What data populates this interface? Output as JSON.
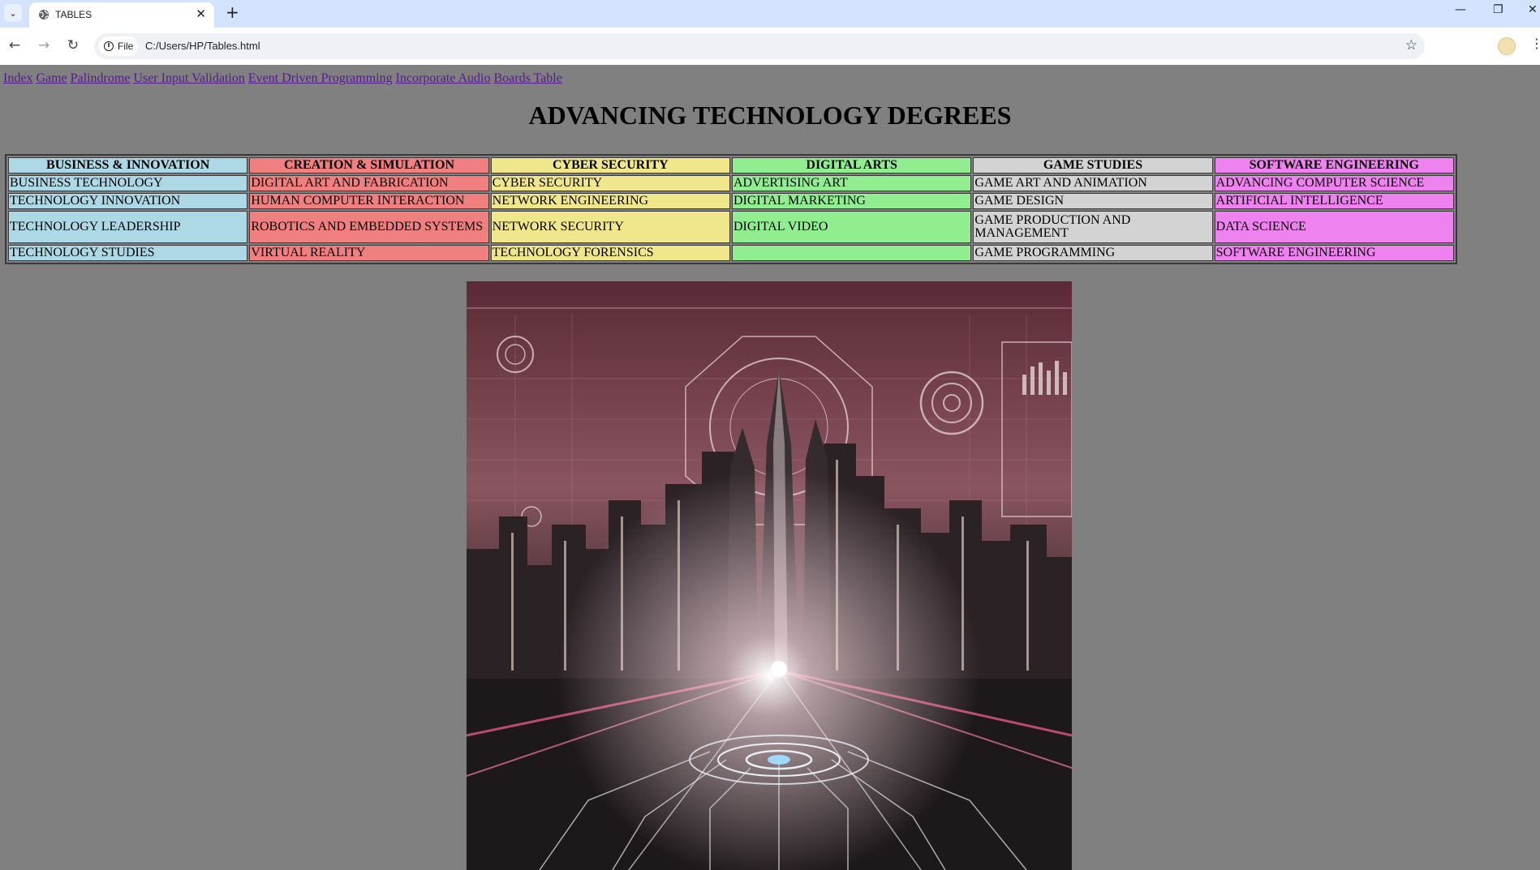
{
  "browser": {
    "tab_title": "TABLES",
    "site_chip": "File",
    "url": "C:/Users/HP/Tables.html"
  },
  "nav": {
    "links": [
      "Index",
      "Game",
      "Palindrome",
      "User Input Validation",
      "Event Driven Programming",
      "Incorporate Audio",
      "Boards Table"
    ]
  },
  "page": {
    "title": "ADVANCING TECHNOLOGY DEGREES"
  },
  "table": {
    "columns": [
      {
        "header": "BUSINESS & INNOVATION",
        "color": "#add8e6",
        "items": [
          "BUSINESS TECHNOLOGY",
          "TECHNOLOGY INNOVATION",
          "TECHNOLOGY LEADERSHIP",
          "TECHNOLOGY STUDIES"
        ]
      },
      {
        "header": "CREATION & SIMULATION",
        "color": "#f08080",
        "items": [
          "DIGITAL ART AND FABRICATION",
          "HUMAN COMPUTER INTERACTION",
          "ROBOTICS AND EMBEDDED SYSTEMS",
          "VIRTUAL REALITY"
        ]
      },
      {
        "header": "CYBER SECURITY",
        "color": "#f0e68c",
        "items": [
          "CYBER SECURITY",
          "NETWORK ENGINEERING",
          "NETWORK SECURITY",
          "TECHNOLOGY FORENSICS"
        ]
      },
      {
        "header": "DIGITAL ARTS",
        "color": "#90ee90",
        "items": [
          "ADVERTISING ART",
          "DIGITAL MARKETING",
          "DIGITAL VIDEO",
          ""
        ]
      },
      {
        "header": "GAME STUDIES",
        "color": "#d3d3d3",
        "items": [
          "GAME ART AND ANIMATION",
          "GAME DESIGN",
          "GAME PRODUCTION AND MANAGEMENT",
          "GAME PROGRAMMING"
        ]
      },
      {
        "header": "SOFTWARE ENGINEERING",
        "color": "#ee82ee",
        "items": [
          "ADVANCING COMPUTER SCIENCE",
          "ARTIFICIAL INTELLIGENCE",
          "DATA SCIENCE",
          "SOFTWARE ENGINEERING"
        ]
      }
    ]
  },
  "hero_image": {
    "icon": "futuristic-city-illustration"
  }
}
